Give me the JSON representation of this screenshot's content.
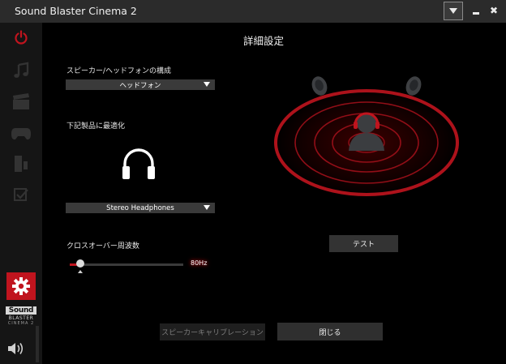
{
  "window": {
    "title": "Sound Blaster Cinema 2"
  },
  "sidebar": {
    "items": [
      {
        "icon": "power-icon"
      },
      {
        "icon": "music-note-icon"
      },
      {
        "icon": "movie-clapper-icon"
      },
      {
        "icon": "gamepad-icon"
      },
      {
        "icon": "speaker-tablet-icon"
      },
      {
        "icon": "checklist-icon"
      }
    ],
    "settings_icon": "gear-icon",
    "logo": {
      "line1": "Sound",
      "line2": "BLASTER",
      "line3": "CINEMA 2"
    },
    "volume_icon": "speaker-volume-icon"
  },
  "page": {
    "title": "詳細設定",
    "speaker_config": {
      "label": "スピーカー/ヘッドフォンの構成",
      "selected": "ヘッドフォン"
    },
    "optimize": {
      "label": "下記製品に最適化",
      "selected": "Stereo Headphones"
    },
    "crossover": {
      "label": "クロスオーバー周波数",
      "value_text": "80Hz",
      "position_fraction": 0.09
    },
    "buttons": {
      "test": "テスト",
      "calibration": "スピーカーキャリブレーション",
      "close": "閉じる"
    }
  },
  "colors": {
    "accent": "#c0141e",
    "background": "#000000",
    "sidebar": "#151515",
    "titlebar": "#2b2b2b"
  }
}
